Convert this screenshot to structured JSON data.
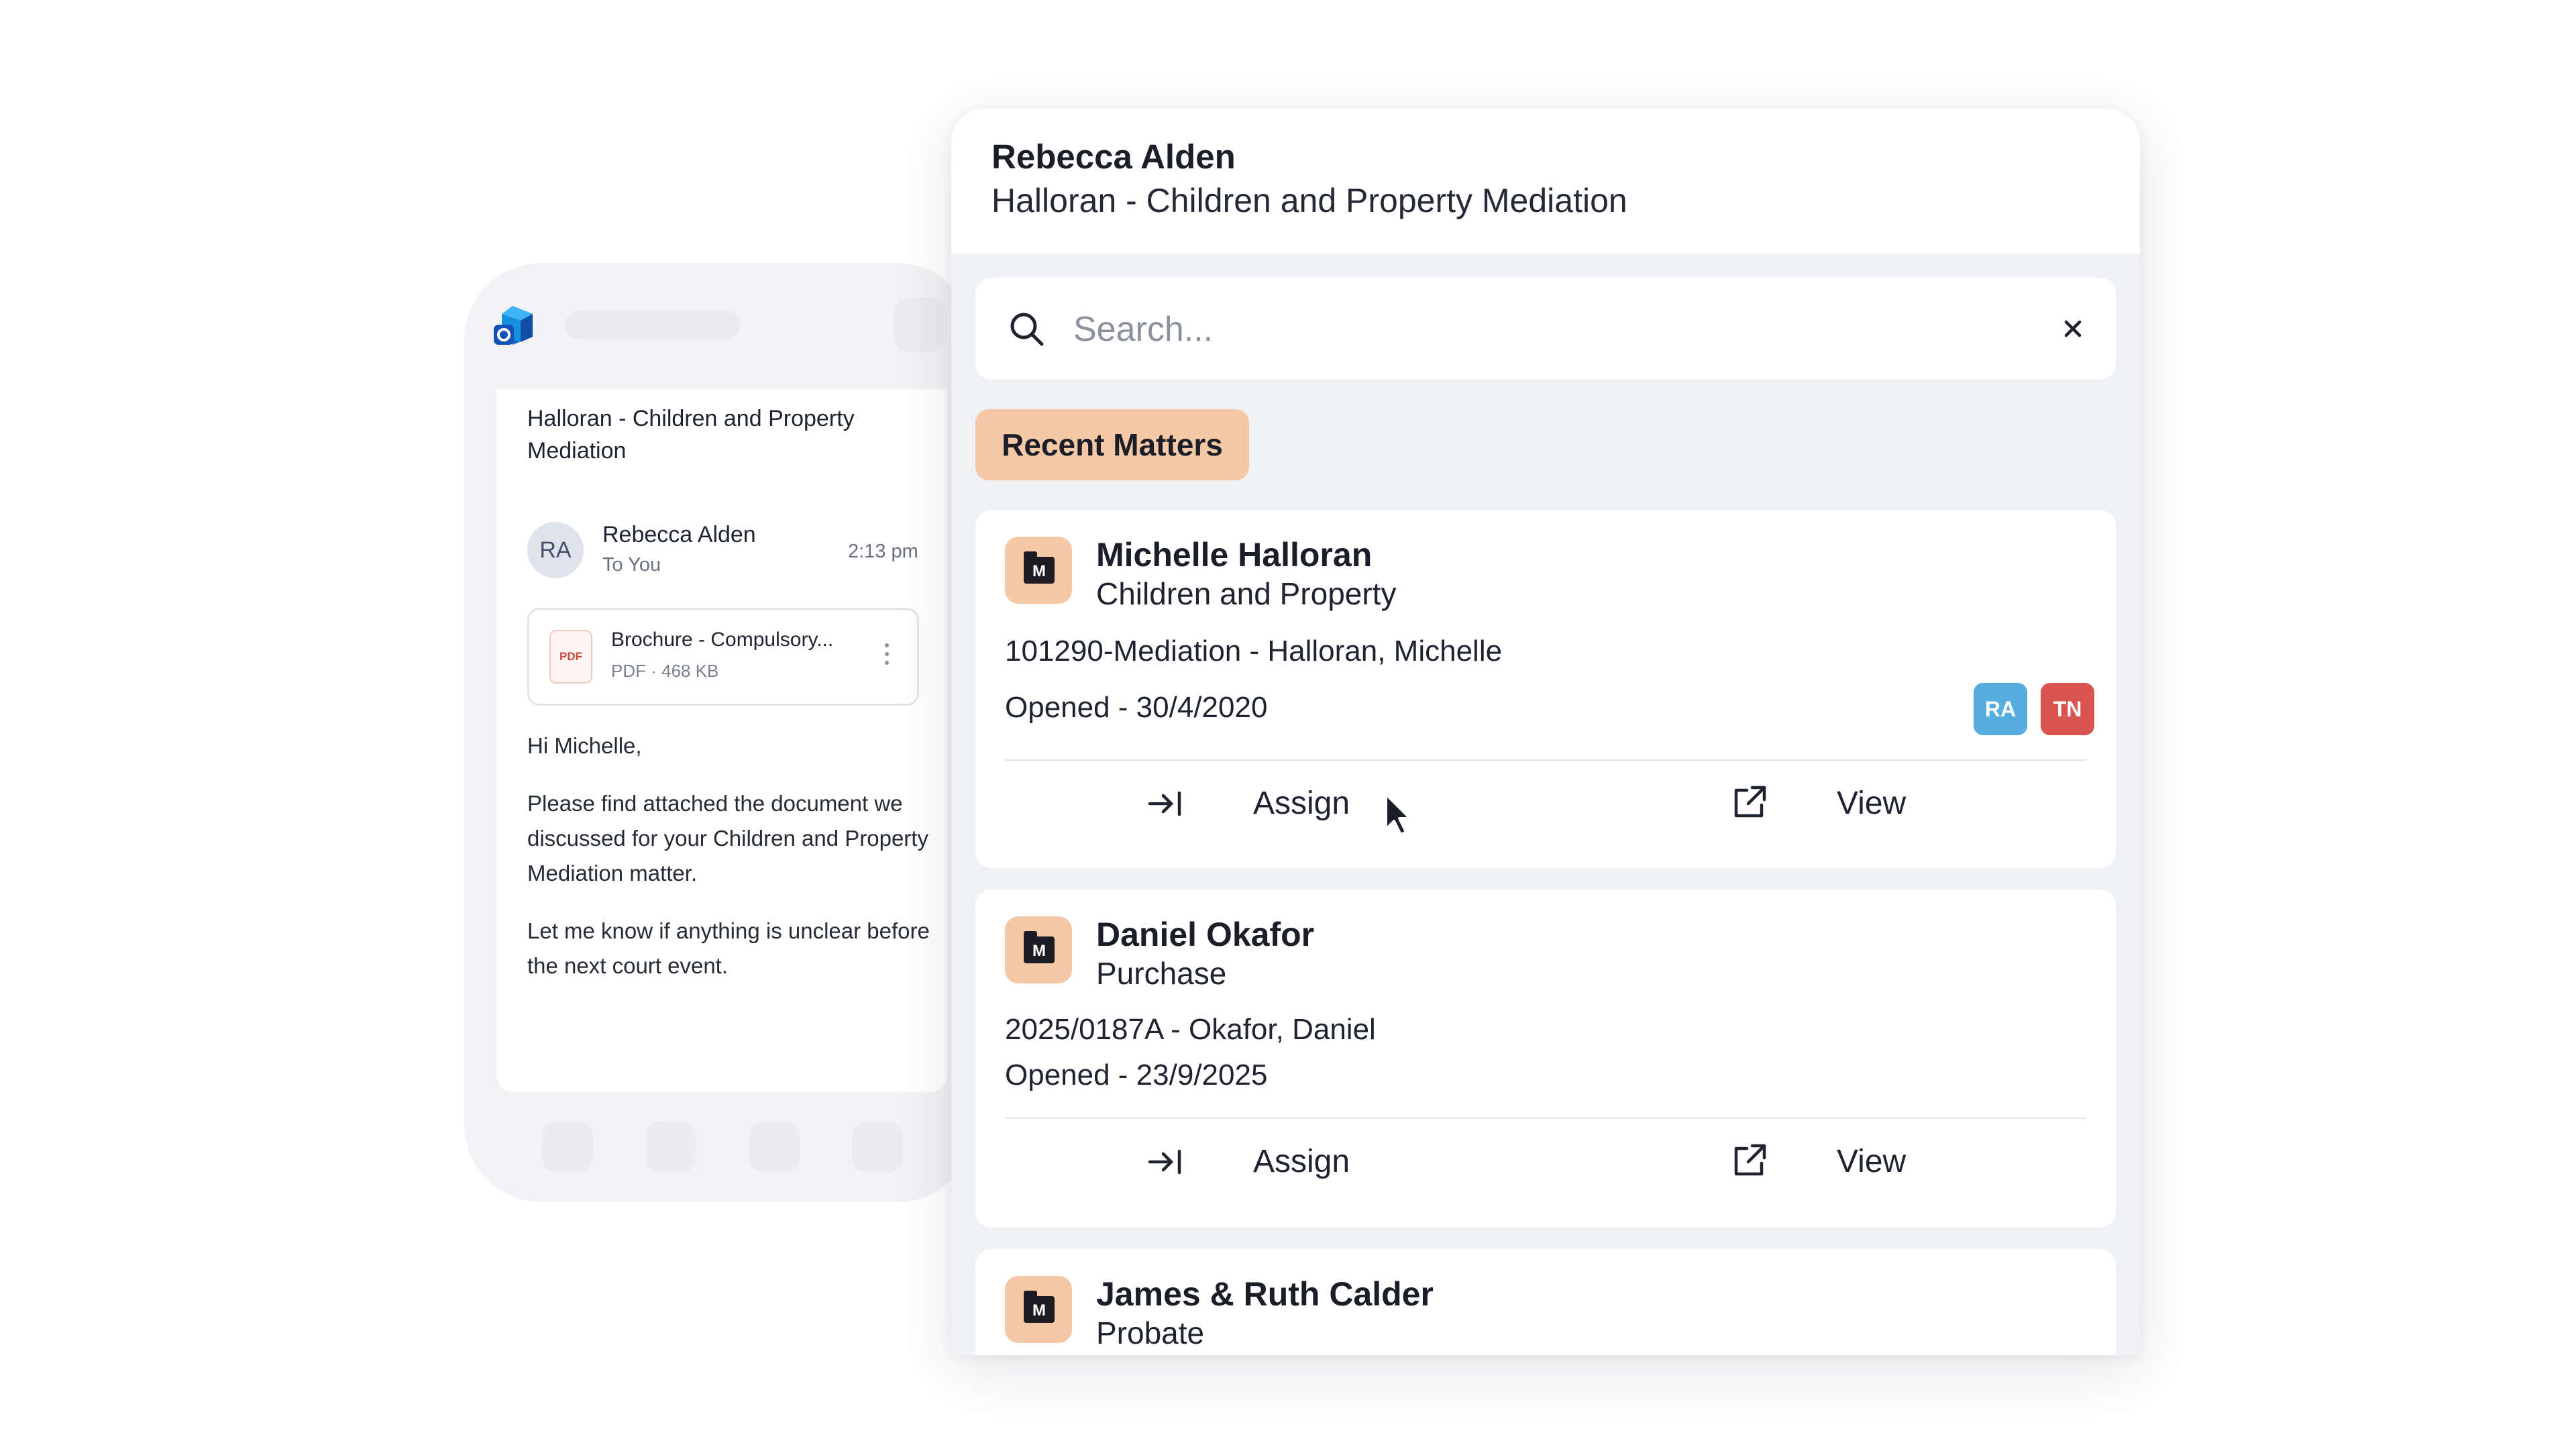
{
  "phone": {
    "email_subject": "Halloran - Children and Property Mediation",
    "sender_initials": "RA",
    "sender_name": "Rebecca Alden",
    "recipient": "To You",
    "time": "2:13 pm",
    "attachment": {
      "type_label": "PDF",
      "name": "Brochure - Compulsory...",
      "meta": "PDF · 468 KB"
    },
    "body": {
      "greeting": "Hi Michelle,",
      "paragraph1": "Please find attached the document we discussed for your Children and Property Mediation matter.",
      "paragraph2": "Let me know if anything is unclear before the next court event."
    }
  },
  "panel": {
    "contact_name": "Rebecca Alden",
    "matter_title": "Halloran - Children and Property Mediation",
    "search": {
      "placeholder": "Search...",
      "value": ""
    },
    "recent_label": "Recent Matters",
    "matters": [
      {
        "icon_letter": "M",
        "client": "Michelle Halloran",
        "type": "Children and Property",
        "reference": "101290-Mediation - Halloran, Michelle",
        "opened": "Opened - 30/4/2020",
        "badges": [
          {
            "initials": "RA",
            "color": "#56aee0"
          },
          {
            "initials": "TN",
            "color": "#d9534f"
          }
        ],
        "assign_label": "Assign",
        "view_label": "View"
      },
      {
        "icon_letter": "M",
        "client": "Daniel Okafor",
        "type": "Purchase",
        "reference": "2025/0187A - Okafor, Daniel",
        "opened": "Opened - 23/9/2025",
        "assign_label": "Assign",
        "view_label": "View"
      },
      {
        "icon_letter": "M",
        "client": "James & Ruth Calder",
        "type": "Probate"
      }
    ]
  },
  "colors": {
    "accent_peach": "#f5c9a6",
    "panel_bg": "#f0f1f4",
    "badge_ra": "#56aee0",
    "badge_tn": "#d9534f"
  },
  "icons": [
    "outlook-icon",
    "search-icon",
    "close-icon",
    "matter-folder-icon",
    "assign-arrow-icon",
    "external-link-icon",
    "more-vertical-icon",
    "pdf-icon",
    "pointer-cursor-icon"
  ]
}
